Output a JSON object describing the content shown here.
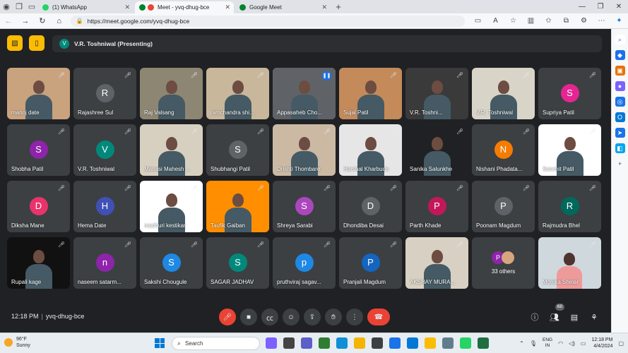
{
  "browser": {
    "tabs": [
      {
        "label": "(1) WhatsApp",
        "color": "#25d366"
      },
      {
        "label": "Meet - yvq-dhug-bce",
        "color": "#ea4335"
      },
      {
        "label": "Google Meet",
        "color": "#00832d"
      }
    ],
    "url": "https://meet.google.com/yvq-dhug-bce"
  },
  "meet": {
    "presenting_initial": "V",
    "presenting_text": "V.R. Toshniwal (Presenting)",
    "participants": [
      {
        "name": "manoj date",
        "initial": "",
        "color": "#c9a27e"
      },
      {
        "name": "Rajashree Sul",
        "initial": "R",
        "color": "#5f6368"
      },
      {
        "name": "Raj Valsang",
        "initial": "",
        "color": "#8d8672"
      },
      {
        "name": "ramchandra shi...",
        "initial": "",
        "color": "#c8b79b"
      },
      {
        "name": "Appasaheb Cho...",
        "initial": "",
        "color": "#5f6368"
      },
      {
        "name": "Sujal Patil",
        "initial": "",
        "color": "#c48a5a"
      },
      {
        "name": "V.R. Toshni...",
        "initial": "",
        "color": "#3a3a3a"
      },
      {
        "name": "V.R. Toshniwal",
        "initial": "",
        "color": "#d9d4c8"
      },
      {
        "name": "Supriya Patil",
        "initial": "S",
        "color": "#e52592"
      },
      {
        "name": "Shobha Patil",
        "initial": "S",
        "color": "#8e24aa"
      },
      {
        "name": "V.R. Toshniwal",
        "initial": "V",
        "color": "#00897b"
      },
      {
        "name": "Manasi Mahesh ...",
        "initial": "",
        "color": "#d7cfc0"
      },
      {
        "name": "Shubhangi Patil",
        "initial": "S",
        "color": "#5f6368"
      },
      {
        "name": "Drishti Thombare",
        "initial": "",
        "color": "#cbb9a4"
      },
      {
        "name": "Harshal Kharbude",
        "initial": "",
        "color": "#e6e6e6"
      },
      {
        "name": "Sanika Salunkhe",
        "initial": "",
        "color": "#202124"
      },
      {
        "name": "Nishani Phadata...",
        "initial": "N",
        "color": "#f57c00"
      },
      {
        "name": "Sanchit Patil",
        "initial": "",
        "color": "#ffffff"
      },
      {
        "name": "Diksha Mane",
        "initial": "D",
        "color": "#e8336b"
      },
      {
        "name": "Hema Date",
        "initial": "H",
        "color": "#3f51b5"
      },
      {
        "name": "madhuri kestikar",
        "initial": "",
        "color": "#ffffff"
      },
      {
        "name": "Taufik Gaiban",
        "initial": "",
        "color": "#ff8f00"
      },
      {
        "name": "Shreya Sarabi",
        "initial": "S",
        "color": "#ab47bc"
      },
      {
        "name": "Dhondiba Desai",
        "initial": "D",
        "color": "#5f6368"
      },
      {
        "name": "Parth Khade",
        "initial": "P",
        "color": "#c2185b"
      },
      {
        "name": "Poonam Magdum",
        "initial": "P",
        "color": "#5f6368"
      },
      {
        "name": "Rajmudra Bhel",
        "initial": "R",
        "color": "#00695c"
      },
      {
        "name": "Rupali kage",
        "initial": "",
        "color": "#111111"
      },
      {
        "name": "naseem satarm...",
        "initial": "n",
        "color": "#8e24aa"
      },
      {
        "name": "Sakshi Chougule",
        "initial": "S",
        "color": "#1e88e5"
      },
      {
        "name": "SAGAR JADHAV",
        "initial": "S",
        "color": "#00897b"
      },
      {
        "name": "pruthviraj sagav...",
        "initial": "p",
        "color": "#1e88e5"
      },
      {
        "name": "Pranjali Magdum",
        "initial": "P",
        "color": "#1565c0"
      },
      {
        "name": "AKSHAY MURA...",
        "initial": "",
        "color": "#d8d0c2"
      }
    ],
    "others_initial": "P",
    "others_label": "33 others",
    "last_tile_name": "Monika Shelar",
    "time": "12:18 PM",
    "meeting_code": "yvq-dhug-bce",
    "participant_count": "68"
  },
  "taskbar": {
    "temp": "96°F",
    "weather": "Sunny",
    "search_placeholder": "Search",
    "lang_line1": "ENG",
    "lang_line2": "IN",
    "time": "12:18 PM",
    "date": "4/4/2024"
  }
}
